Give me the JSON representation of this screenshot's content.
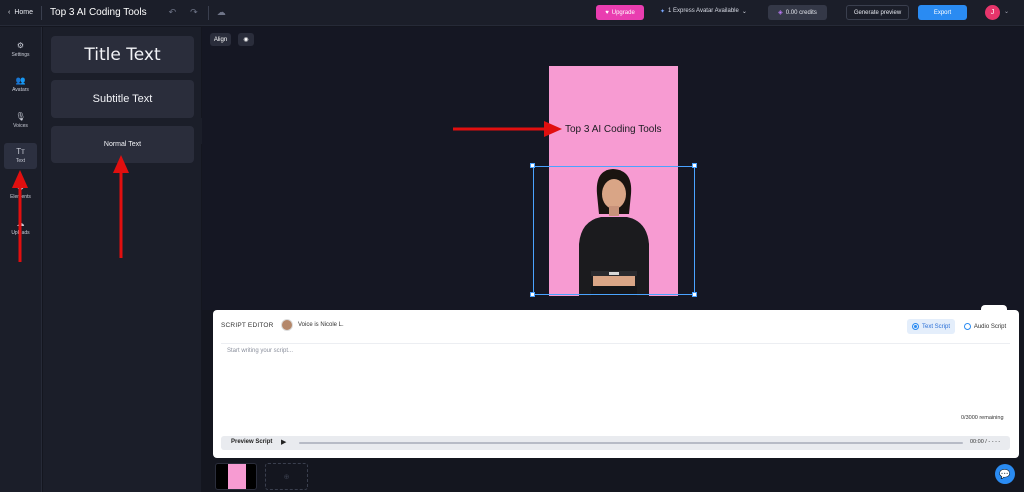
{
  "topbar": {
    "home_label": "Home",
    "project_title": "Top 3 AI Coding Tools",
    "upgrade_label": "Upgrade",
    "express_label": "1 Express Avatar Available",
    "credits_label": "0.00 credits",
    "generate_preview_label": "Generate preview",
    "export_label": "Export",
    "avatar_initial": "J"
  },
  "rail": {
    "items": [
      {
        "label": "Settings",
        "icon": "gear-icon"
      },
      {
        "label": "Avatars",
        "icon": "people-icon"
      },
      {
        "label": "Voices",
        "icon": "mic-icon"
      },
      {
        "label": "Text",
        "icon": "text-icon"
      },
      {
        "label": "Elements",
        "icon": "shapes-icon"
      },
      {
        "label": "Uploads",
        "icon": "upload-icon"
      }
    ]
  },
  "text_panel": {
    "title_text": "Title Text",
    "subtitle_text": "Subtitle Text",
    "normal_text": "Normal Text"
  },
  "canvas": {
    "align_label": "Align",
    "frame_title": "Top 3 AI Coding Tools",
    "frame_background": "#f79bd2"
  },
  "script_editor": {
    "header": "SCRIPT EDITOR",
    "voice_label": "Voice is Nicole L.",
    "text_script_label": "Text Script",
    "audio_script_label": "Audio Script",
    "placeholder": "Start writing your script...",
    "remaining": "0/3000 remaining",
    "preview_label": "Preview Script",
    "time": "00:00 / - - - -"
  },
  "colors": {
    "accent": "#2a8bf2",
    "upgrade": "#e93db0",
    "arrow": "#e10f0f"
  }
}
